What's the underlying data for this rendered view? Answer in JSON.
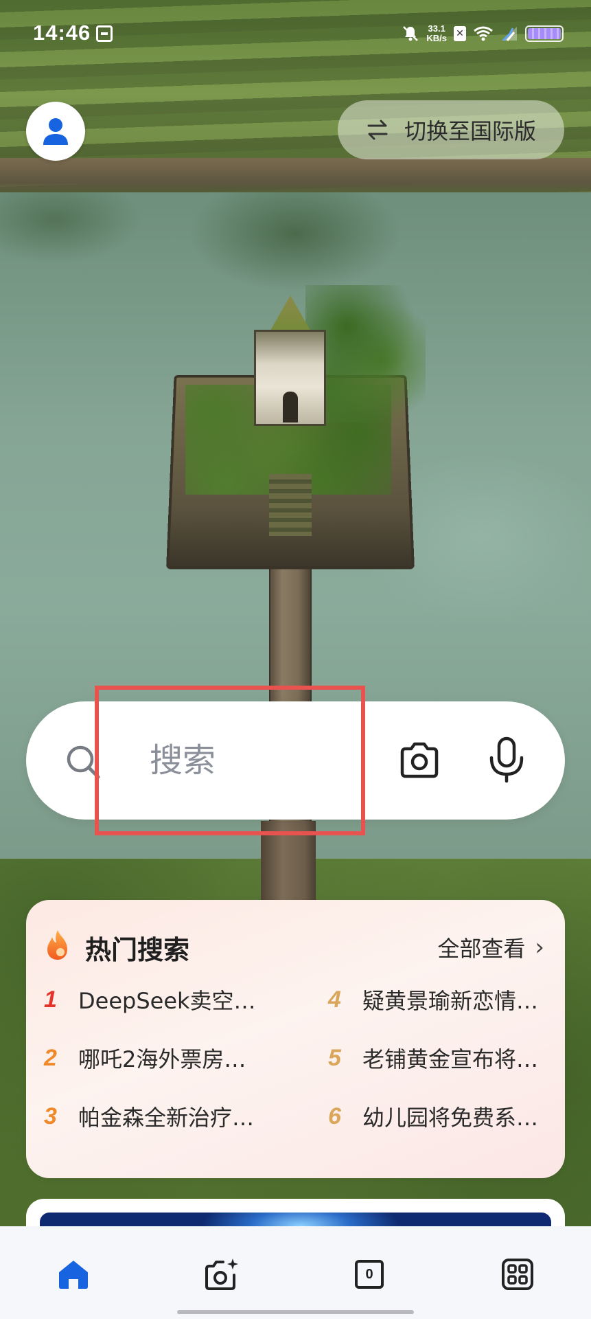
{
  "status_bar": {
    "time": "14:46",
    "network_speed_value": "33.1",
    "network_speed_unit": "KB/s",
    "icons": [
      "notification-icon",
      "mute-icon",
      "network-speed",
      "sim-x-icon",
      "wifi-icon",
      "signal-icon",
      "battery-icon"
    ]
  },
  "header": {
    "switch_label": "切换至国际版",
    "switch_icon": "swap-arrows-icon",
    "avatar_icon": "user-icon",
    "accent_color": "#1763e0"
  },
  "search": {
    "placeholder": "搜索",
    "icons": [
      "search-icon",
      "camera-icon",
      "microphone-icon"
    ],
    "highlight_color": "#e9534f"
  },
  "hot_search": {
    "title": "热门搜索",
    "view_all_label": "全部查看",
    "items": [
      {
        "rank": "1",
        "text": "DeepSeek卖空…"
      },
      {
        "rank": "2",
        "text": "哪吒2海外票房…"
      },
      {
        "rank": "3",
        "text": "帕金森全新治疗…"
      },
      {
        "rank": "4",
        "text": "疑黄景瑜新恋情…"
      },
      {
        "rank": "5",
        "text": "老铺黄金宣布将…"
      },
      {
        "rank": "6",
        "text": "幼儿园将免费系…"
      }
    ],
    "rank_colors": {
      "1": "#e3352b",
      "2": "#f0892a",
      "3": "#f0892a",
      "4": "#d9a65a",
      "5": "#d9a65a",
      "6": "#d9a65a"
    }
  },
  "bottom_nav": {
    "tab_count": "0",
    "items": [
      "home-icon",
      "ai-camera-icon",
      "tabs-icon",
      "apps-grid-icon"
    ],
    "active_color": "#1763e0"
  }
}
